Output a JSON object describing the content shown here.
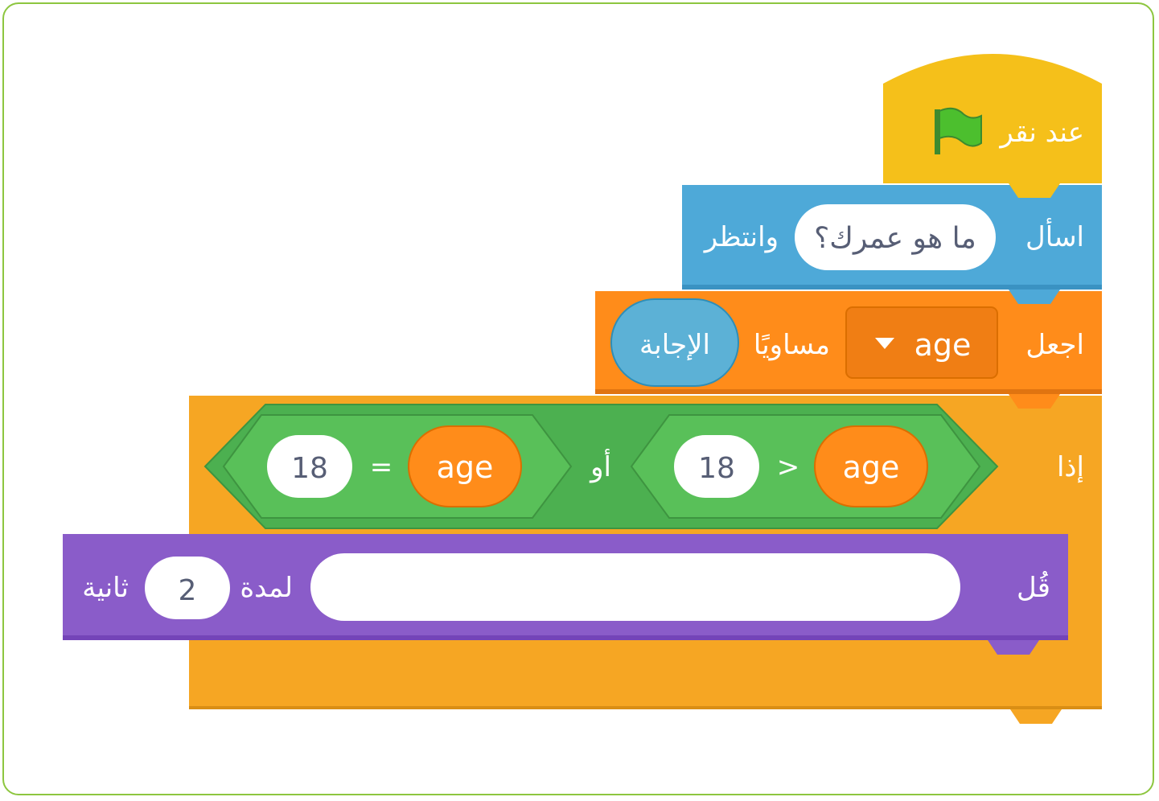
{
  "script": {
    "hat": {
      "label": "عند نقر",
      "icon": "green-flag-icon"
    },
    "ask": {
      "label": "اسأل",
      "question": "ما هو عمرك؟",
      "suffix": "وانتظر"
    },
    "set": {
      "label": "اجعل",
      "variable": "age",
      "middle": "مساويًا",
      "value": "الإجابة"
    },
    "if": {
      "label": "إذا",
      "condition": {
        "left": {
          "variable": "age",
          "operator": ">",
          "value": "18"
        },
        "joiner": "أو",
        "right": {
          "variable": "age",
          "operator": "=",
          "value": "18"
        }
      }
    },
    "say": {
      "label": "قُل",
      "message": "",
      "for_label": "لمدة",
      "duration": "2",
      "unit": "ثانية"
    }
  },
  "colors": {
    "events": "#ffbf00",
    "sensing": "#5cb1d6",
    "variables": "#ff8c1a",
    "control": "#ffab19",
    "operators": "#59c059",
    "looks": "#9966ff",
    "frame": "#8dc63f"
  }
}
